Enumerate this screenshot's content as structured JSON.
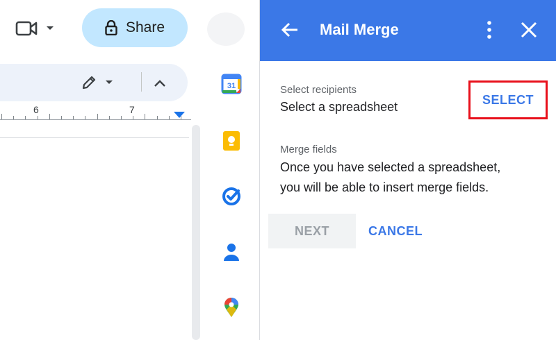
{
  "topbar": {
    "share_label": "Share",
    "camera_icon": "video-camera-icon",
    "share_icon": "lock-icon"
  },
  "toolbar": {
    "edit_mode_icon": "pencil-icon",
    "collapse_icon": "chevron-up-icon"
  },
  "ruler": {
    "numbers": [
      "6",
      "7"
    ]
  },
  "side_apps": [
    {
      "name": "calendar-icon",
      "label": "31"
    },
    {
      "name": "keep-icon"
    },
    {
      "name": "tasks-icon"
    },
    {
      "name": "contacts-icon"
    },
    {
      "name": "maps-icon"
    }
  ],
  "panel": {
    "title": "Mail Merge",
    "recipients_caption": "Select recipients",
    "recipients_value": "Select a spreadsheet",
    "select_label": "SELECT",
    "merge_caption": "Merge fields",
    "merge_line1": "Once you have selected a spreadsheet,",
    "merge_line2": "you will be able to insert merge fields.",
    "next_label": "NEXT",
    "cancel_label": "CANCEL"
  },
  "colors": {
    "panel_header": "#3b78e7",
    "share_bg": "#c2e7ff",
    "highlight_border": "#e8101b",
    "link": "#3b78e7"
  }
}
